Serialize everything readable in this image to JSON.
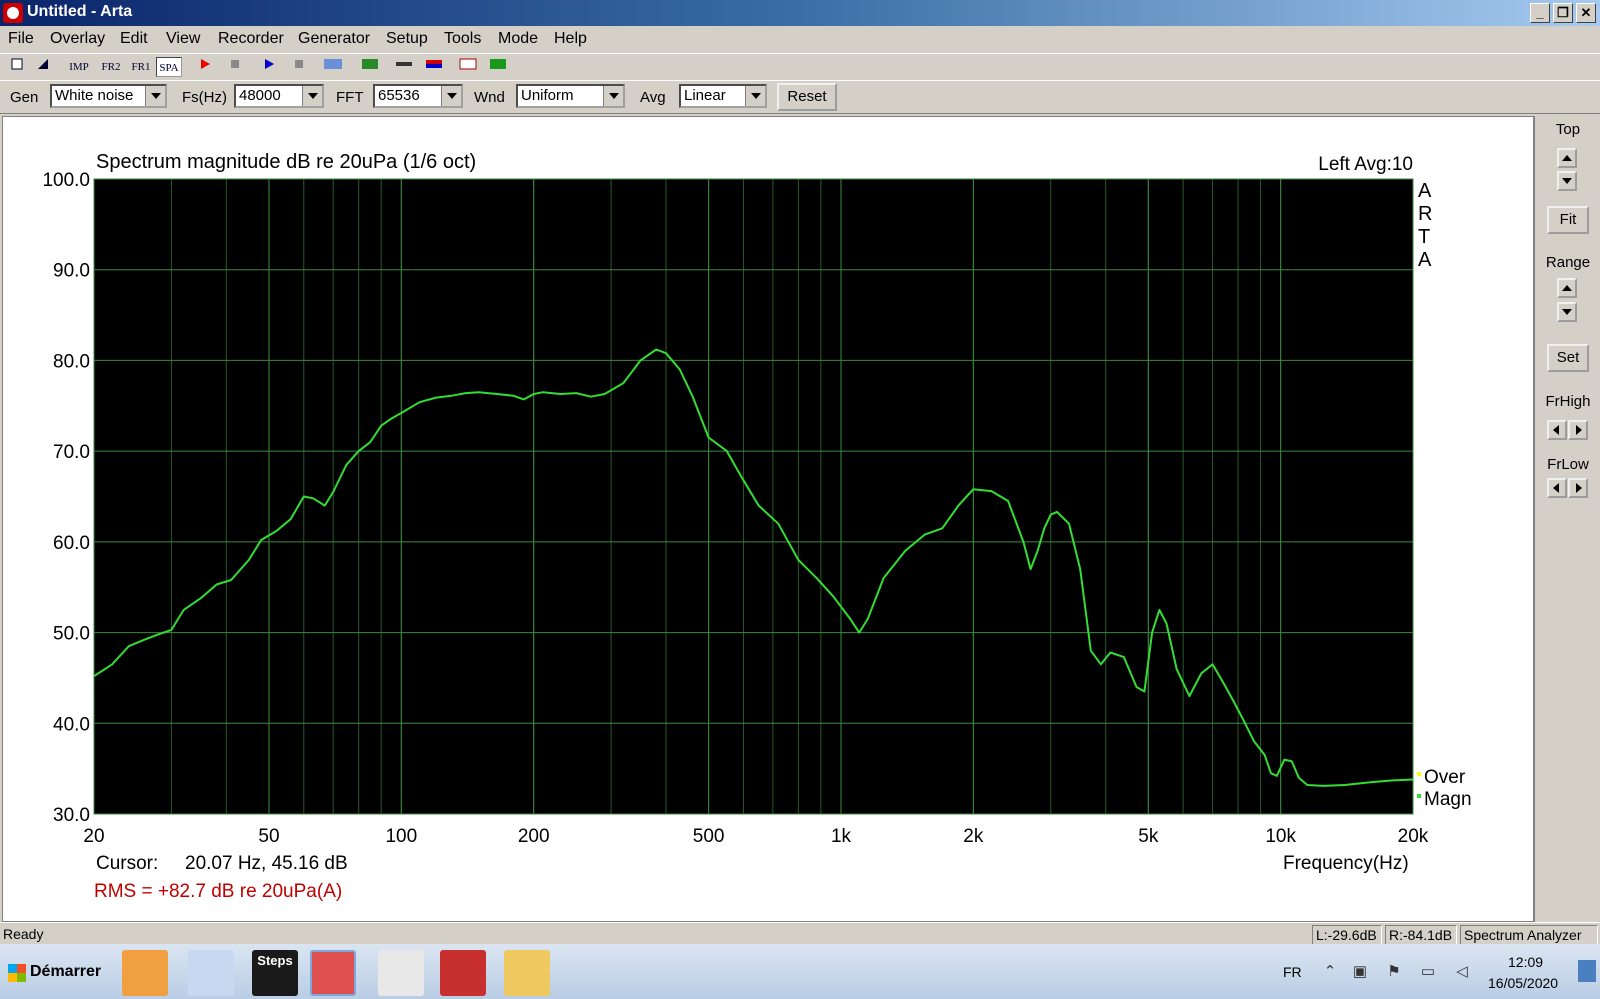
{
  "window": {
    "title": "Untitled - Arta"
  },
  "menu": [
    "File",
    "Overlay",
    "Edit",
    "View",
    "Recorder",
    "Generator",
    "Setup",
    "Tools",
    "Mode",
    "Help"
  ],
  "toolbar_buttons": [
    "IMP",
    "FR2",
    "FR1",
    "SPA"
  ],
  "controls": {
    "gen_label": "Gen",
    "gen_value": "White noise",
    "fs_label": "Fs(Hz)",
    "fs_value": "48000",
    "fft_label": "FFT",
    "fft_value": "65536",
    "wnd_label": "Wnd",
    "wnd_value": "Uniform",
    "avg_label": "Avg",
    "avg_value": "Linear",
    "reset_label": "Reset"
  },
  "chart_data": {
    "type": "line",
    "title": "Spectrum magnitude dB re 20uPa (1/6 oct)",
    "channel_info": "Left  Avg:10",
    "watermark": "ARTA",
    "xlabel": "Frequency(Hz)",
    "xscale": "log",
    "xlim": [
      20,
      20000
    ],
    "ylim": [
      30,
      100
    ],
    "x_ticks": [
      20,
      50,
      100,
      200,
      500,
      1000,
      2000,
      5000,
      10000,
      20000
    ],
    "x_tick_labels": [
      "20",
      "50",
      "100",
      "200",
      "500",
      "1k",
      "2k",
      "5k",
      "10k",
      "20k"
    ],
    "y_ticks": [
      30,
      40,
      50,
      60,
      70,
      80,
      90,
      100
    ],
    "y_tick_labels": [
      "30.0",
      "40.0",
      "50.0",
      "60.0",
      "70.0",
      "80.0",
      "90.0",
      "100.0"
    ],
    "grid": true,
    "legend": [
      "Over",
      "Magn"
    ],
    "legend_colors": [
      "#ffff00",
      "#33dd33"
    ],
    "line_color": "#33dd33",
    "series": [
      {
        "name": "Magn",
        "x": [
          20,
          22,
          24,
          26,
          28,
          30,
          32,
          35,
          38,
          41,
          45,
          48,
          52,
          56,
          60,
          63,
          67,
          70,
          75,
          80,
          85,
          90,
          95,
          100,
          110,
          120,
          130,
          140,
          150,
          165,
          180,
          190,
          200,
          210,
          230,
          250,
          270,
          290,
          320,
          350,
          380,
          400,
          430,
          460,
          500,
          550,
          600,
          650,
          720,
          800,
          880,
          960,
          1050,
          1100,
          1150,
          1250,
          1400,
          1550,
          1700,
          1850,
          2000,
          2200,
          2400,
          2600,
          2700,
          2800,
          2900,
          3000,
          3100,
          3300,
          3500,
          3700,
          3900,
          4100,
          4400,
          4700,
          4900,
          5100,
          5300,
          5500,
          5800,
          6200,
          6600,
          7000,
          7400,
          7800,
          8200,
          8700,
          9200,
          9500,
          9800,
          10200,
          10600,
          11000,
          11500,
          12500,
          14000,
          16000,
          18000,
          20000
        ],
        "values": [
          45.2,
          46.5,
          48.5,
          49.2,
          49.8,
          50.3,
          52.5,
          53.8,
          55.3,
          55.8,
          58.0,
          60.2,
          61.2,
          62.5,
          65.0,
          64.8,
          64.0,
          65.5,
          68.5,
          70.0,
          71.0,
          72.8,
          73.6,
          74.2,
          75.4,
          75.9,
          76.1,
          76.4,
          76.5,
          76.3,
          76.1,
          75.7,
          76.3,
          76.5,
          76.3,
          76.4,
          76.0,
          76.3,
          77.5,
          80.0,
          81.2,
          80.8,
          79.0,
          76.0,
          71.5,
          70.0,
          66.8,
          64.0,
          62.0,
          58.0,
          56.0,
          54.0,
          51.5,
          50.0,
          51.5,
          56.0,
          59.0,
          60.8,
          61.5,
          64.0,
          65.8,
          65.6,
          64.5,
          60.0,
          57.0,
          59.0,
          61.5,
          63.0,
          63.3,
          62.0,
          57.0,
          48.0,
          46.5,
          47.8,
          47.3,
          44.0,
          43.5,
          50.0,
          52.5,
          51.0,
          46.0,
          43.0,
          45.5,
          46.5,
          44.5,
          42.5,
          40.5,
          38.0,
          36.5,
          34.5,
          34.2,
          36.0,
          35.8,
          34.0,
          33.2,
          33.1,
          33.2,
          33.5,
          33.7,
          33.8
        ]
      }
    ]
  },
  "cursor_readout": {
    "label": "Cursor:",
    "value": "20.07 Hz, 45.16 dB"
  },
  "rms_readout": "RMS =  +82.7 dB re 20uPa(A)",
  "side_panel": {
    "top_label": "Top",
    "fit_label": "Fit",
    "range_label": "Range",
    "set_label": "Set",
    "frhigh_label": "FrHigh",
    "frlow_label": "FrLow"
  },
  "status": {
    "ready": "Ready",
    "left_level": "L:-29.6dB",
    "right_level": "R:-84.1dB",
    "mode": "Spectrum Analyzer"
  },
  "taskbar": {
    "start_label": "Démarrer",
    "steps_label": "Steps",
    "lang": "FR",
    "time": "12:09",
    "date": "16/05/2020"
  }
}
